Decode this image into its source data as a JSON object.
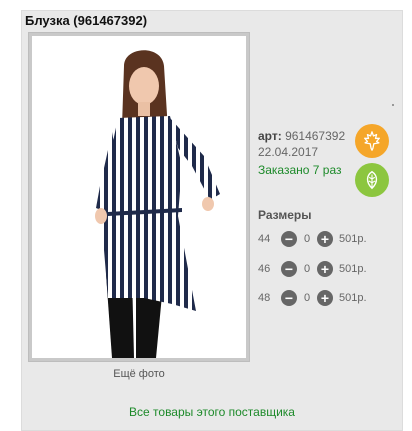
{
  "product": {
    "title": "Блузка (961467392)",
    "art_label": "арт:",
    "art_number": "961467392",
    "date": "22.04.2017",
    "ordered": "Заказано 7 раз"
  },
  "photo": {
    "more_label": "Ещё фото"
  },
  "badges": [
    {
      "icon": "maple-leaf-icon",
      "color": "#f5a629"
    },
    {
      "icon": "leaf-icon",
      "color": "#8cc63f"
    }
  ],
  "sizes": {
    "title": "Размеры",
    "rows": [
      {
        "size": "44",
        "qty": "0",
        "price": "501р."
      },
      {
        "size": "46",
        "qty": "0",
        "price": "501р."
      },
      {
        "size": "48",
        "qty": "0",
        "price": "501р."
      }
    ]
  },
  "footer": {
    "supplier_link": "Все товары этого поставщика"
  },
  "colors": {
    "accent_green": "#1d8a2a",
    "stripe_navy": "#1f2a4a"
  }
}
